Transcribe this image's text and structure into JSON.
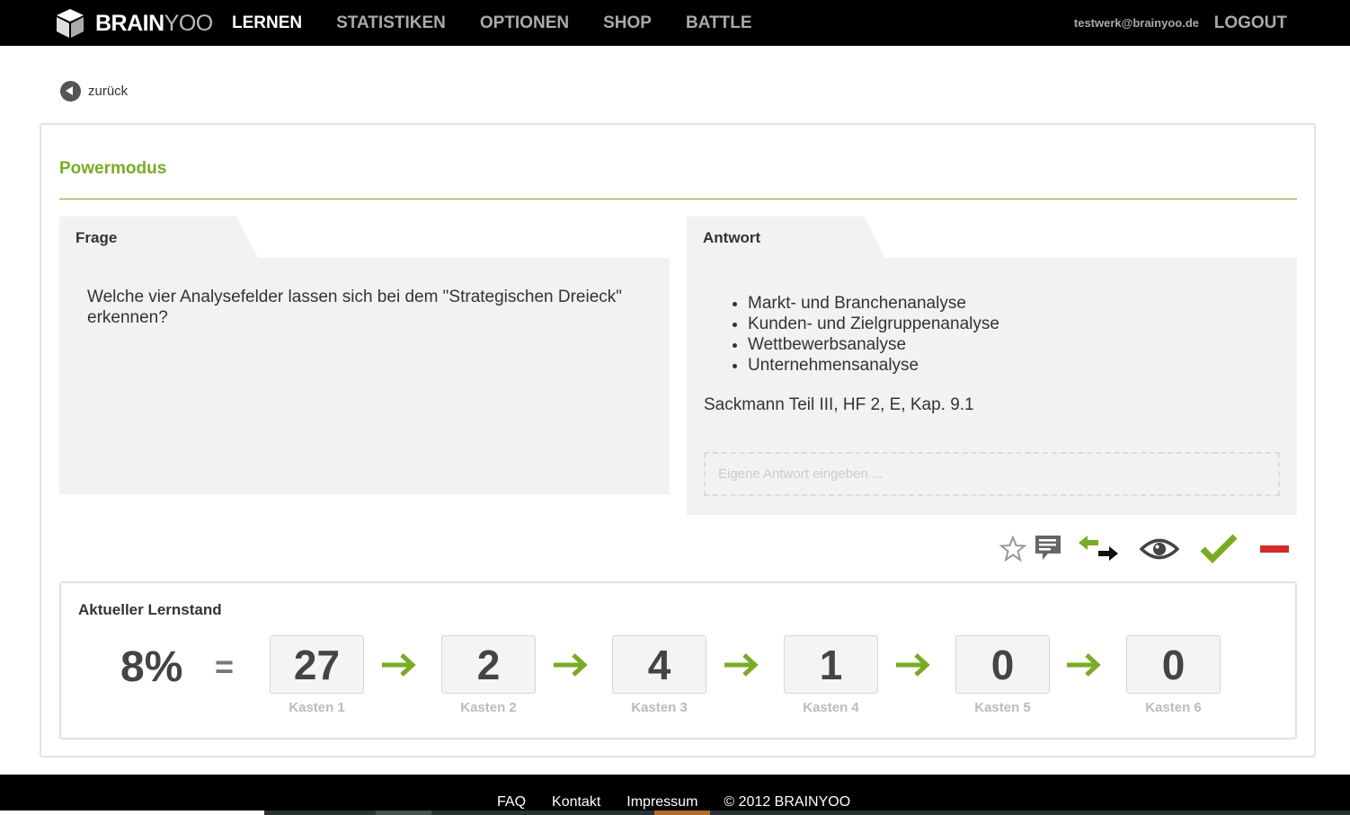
{
  "brand": {
    "name_bold": "BRAIN",
    "name_light": "YOO"
  },
  "nav": {
    "items": [
      {
        "label": "LERNEN",
        "active": true
      },
      {
        "label": "STATISTIKEN",
        "active": false
      },
      {
        "label": "OPTIONEN",
        "active": false
      },
      {
        "label": "SHOP",
        "active": false
      },
      {
        "label": "BATTLE",
        "active": false
      }
    ],
    "user_email": "testwerk@brainyoo.de",
    "logout_label": "LOGOUT"
  },
  "back": {
    "label": "zurück"
  },
  "mode": {
    "title": "Powermodus"
  },
  "question": {
    "tab_label": "Frage",
    "text": "Welche vier Analysefelder lassen sich bei dem \"Strategischen Dreieck\" erkennen?"
  },
  "answer": {
    "tab_label": "Antwort",
    "items": [
      "Markt- und Branchenanalyse",
      "Kunden- und Zielgruppenanalyse",
      "Wettbewerbsanalyse",
      "Unternehmensanalyse"
    ],
    "source": "Sackmann Teil III, HF 2, E, Kap. 9.1",
    "own_answer_placeholder": "Eigene Antwort eingeben ..."
  },
  "actions": {
    "icons": [
      "star-icon",
      "comment-icon",
      "swap-icon",
      "eye-icon",
      "check-icon",
      "minus-icon"
    ]
  },
  "status": {
    "title": "Aktueller Lernstand",
    "percent": "8%",
    "equals": "=",
    "boxes": [
      {
        "count": "27",
        "label": "Kasten 1"
      },
      {
        "count": "2",
        "label": "Kasten 2"
      },
      {
        "count": "4",
        "label": "Kasten 3"
      },
      {
        "count": "1",
        "label": "Kasten 4"
      },
      {
        "count": "0",
        "label": "Kasten 5"
      },
      {
        "count": "0",
        "label": "Kasten 6"
      }
    ]
  },
  "footer": {
    "links": [
      "FAQ",
      "Kontakt",
      "Impressum"
    ],
    "copyright": "© 2012 BRAINYOO"
  },
  "colors": {
    "accent_green": "#7aab24",
    "danger_red": "#d42a2a",
    "nav_bg": "#000000",
    "panel_bg": "#f2f2f2"
  }
}
